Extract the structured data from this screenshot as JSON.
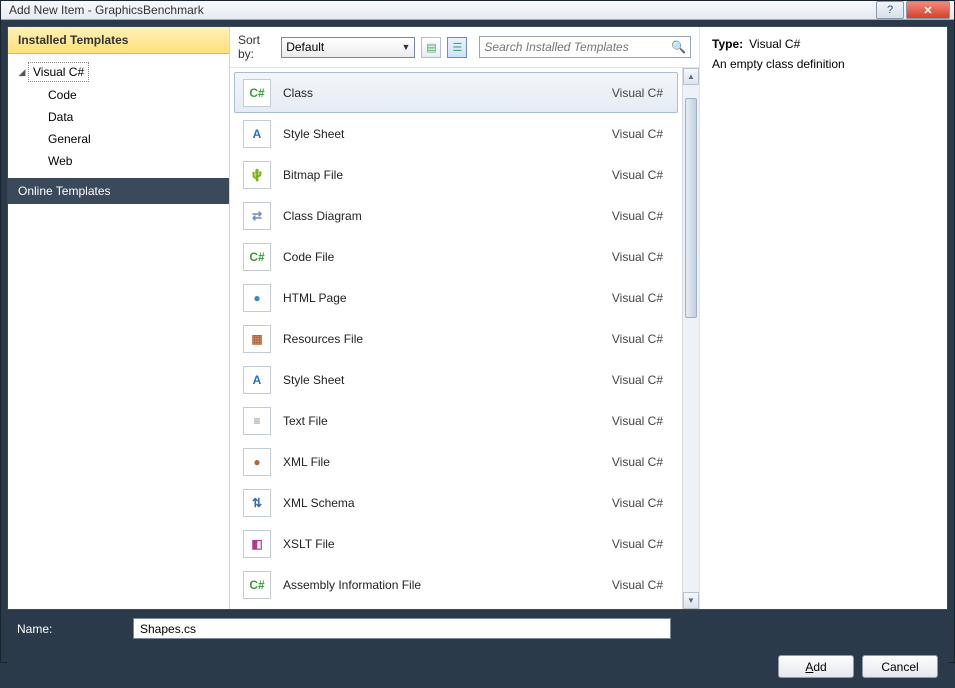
{
  "window": {
    "title": "Add New Item - GraphicsBenchmark"
  },
  "sidebar": {
    "header": "Installed Templates",
    "root": {
      "label": "Visual C#"
    },
    "children": [
      {
        "label": "Code"
      },
      {
        "label": "Data"
      },
      {
        "label": "General"
      },
      {
        "label": "Web"
      }
    ],
    "online": "Online Templates"
  },
  "toolbar": {
    "sort_label": "Sort by:",
    "sort_value": "Default",
    "search_placeholder": "Search Installed Templates"
  },
  "templates": [
    {
      "name": "Class",
      "lang": "Visual C#",
      "icon": "C#",
      "cls": "ic-cs",
      "selected": true
    },
    {
      "name": "Style Sheet",
      "lang": "Visual C#",
      "icon": "A",
      "cls": "ic-css"
    },
    {
      "name": "Bitmap File",
      "lang": "Visual C#",
      "icon": "🌵",
      "cls": "ic-bmp"
    },
    {
      "name": "Class Diagram",
      "lang": "Visual C#",
      "icon": "⇄",
      "cls": "ic-cd"
    },
    {
      "name": "Code File",
      "lang": "Visual C#",
      "icon": "C#",
      "cls": "ic-cs"
    },
    {
      "name": "HTML Page",
      "lang": "Visual C#",
      "icon": "●",
      "cls": "ic-html"
    },
    {
      "name": "Resources File",
      "lang": "Visual C#",
      "icon": "▦",
      "cls": "ic-res"
    },
    {
      "name": "Style Sheet",
      "lang": "Visual C#",
      "icon": "A",
      "cls": "ic-css"
    },
    {
      "name": "Text File",
      "lang": "Visual C#",
      "icon": "≡",
      "cls": "ic-txt"
    },
    {
      "name": "XML File",
      "lang": "Visual C#",
      "icon": "●",
      "cls": "ic-xml"
    },
    {
      "name": "XML Schema",
      "lang": "Visual C#",
      "icon": "⇅",
      "cls": "ic-xsd"
    },
    {
      "name": "XSLT File",
      "lang": "Visual C#",
      "icon": "◧",
      "cls": "ic-xslt"
    },
    {
      "name": "Assembly Information File",
      "lang": "Visual C#",
      "icon": "C#",
      "cls": "ic-cs"
    }
  ],
  "details": {
    "type_label": "Type:",
    "type_value": "Visual C#",
    "description": "An empty class definition"
  },
  "name_field": {
    "label": "Name:",
    "value": "Shapes.cs"
  },
  "buttons": {
    "add_prefix": "A",
    "add_rest": "dd",
    "cancel": "Cancel"
  }
}
